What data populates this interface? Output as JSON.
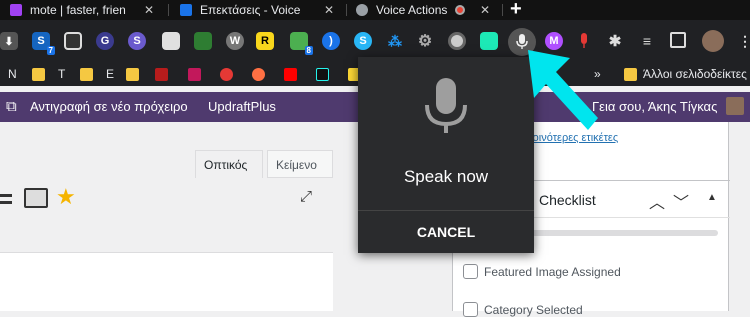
{
  "tabs": [
    {
      "title": "mote | faster, frien",
      "color": "#a142f4"
    },
    {
      "title": "Επεκτάσεις - Voice",
      "color": "#1a73e8"
    },
    {
      "title": "Voice Actions",
      "color": "#9aa0a6"
    }
  ],
  "new_tab_label": "+",
  "toolbar": {
    "badges": {
      "ext1": "7",
      "ext2": "8"
    }
  },
  "bookmarks": {
    "items": [
      {
        "label": "N"
      },
      {
        "label": "T"
      },
      {
        "label": "E"
      }
    ],
    "more": "»",
    "other_folder": "Άλλοι σελιδοδείκτες"
  },
  "wp_admin_bar": {
    "copy_draft": "Αντιγραφή σε νέο πρόχειρο",
    "updraft": "UpdraftPlus",
    "greeting": "Γεια σου, Άκης Τίγκας"
  },
  "editor": {
    "tab_visual": "Οπτικός",
    "tab_text": "Κείμενο"
  },
  "sidebar": {
    "tags_link": "ό τις κοινότερες ετικέτες",
    "panel_title": "Checklist",
    "checklist": [
      {
        "label": "Featured Image Assigned"
      },
      {
        "label": "Category Selected"
      }
    ]
  },
  "speech_popup": {
    "prompt": "Speak now",
    "cancel": "CANCEL"
  },
  "colors": {
    "arrow": "#00e5ee",
    "wp_bar": "#4f3a6e",
    "popup_bg": "#2a2b2d"
  }
}
